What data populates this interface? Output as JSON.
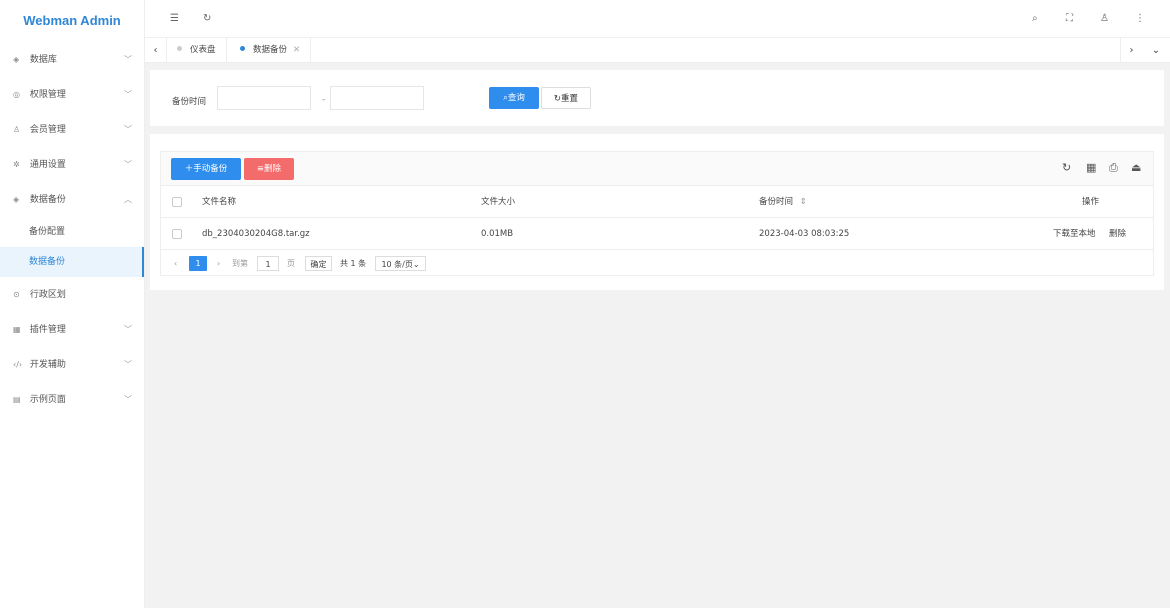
{
  "app": {
    "title": "Webman Admin"
  },
  "sidebar": {
    "items": [
      {
        "label": "数据库",
        "icon": "layers-icon",
        "expanded": false
      },
      {
        "label": "权限管理",
        "icon": "shield-icon",
        "expanded": false
      },
      {
        "label": "会员管理",
        "icon": "user-icon",
        "expanded": false
      },
      {
        "label": "通用设置",
        "icon": "gear-icon",
        "expanded": false
      },
      {
        "label": "数据备份",
        "icon": "layers-icon",
        "expanded": true,
        "children": [
          {
            "label": "备份配置"
          },
          {
            "label": "数据备份",
            "active": true
          }
        ]
      },
      {
        "label": "行政区划",
        "icon": "location-icon",
        "expanded": false
      },
      {
        "label": "插件管理",
        "icon": "plugin-icon",
        "expanded": false
      },
      {
        "label": "开发辅助",
        "icon": "code-icon",
        "expanded": false
      },
      {
        "label": "示例页面",
        "icon": "grid-icon",
        "expanded": false
      }
    ]
  },
  "header": {
    "left_icons": [
      "menu-fold-icon",
      "refresh-icon"
    ],
    "right_icons": [
      "search-icon",
      "fullscreen-icon",
      "user-icon",
      "more-icon"
    ]
  },
  "tabs": [
    {
      "label": "仪表盘",
      "active": false
    },
    {
      "label": "数据备份",
      "active": true,
      "closable": true
    }
  ],
  "filter": {
    "label": "备份时间",
    "start_value": "",
    "end_value": "",
    "separator": "-",
    "search_label": "查询",
    "reset_label": "重置"
  },
  "toolbar": {
    "add_label": "手动备份",
    "delete_label": "删除"
  },
  "table": {
    "columns": [
      "文件名称",
      "文件大小",
      "备份时间",
      "操作"
    ],
    "rows": [
      {
        "name": "db_2304030204G8.tar.gz",
        "size": "0.01MB",
        "time": "2023-04-03 08:03:25",
        "actions": [
          "下载至本地",
          "删除"
        ]
      }
    ]
  },
  "pager": {
    "current": "1",
    "goto_label": "到第",
    "goto_value": "1",
    "page_unit": "页",
    "confirm_label": "确定",
    "total_label": "共 1 条",
    "page_size_label": "10 条/页"
  },
  "colors": {
    "accent": "#2e8ded",
    "danger": "#f36b6b",
    "brand": "#2f87d6"
  }
}
